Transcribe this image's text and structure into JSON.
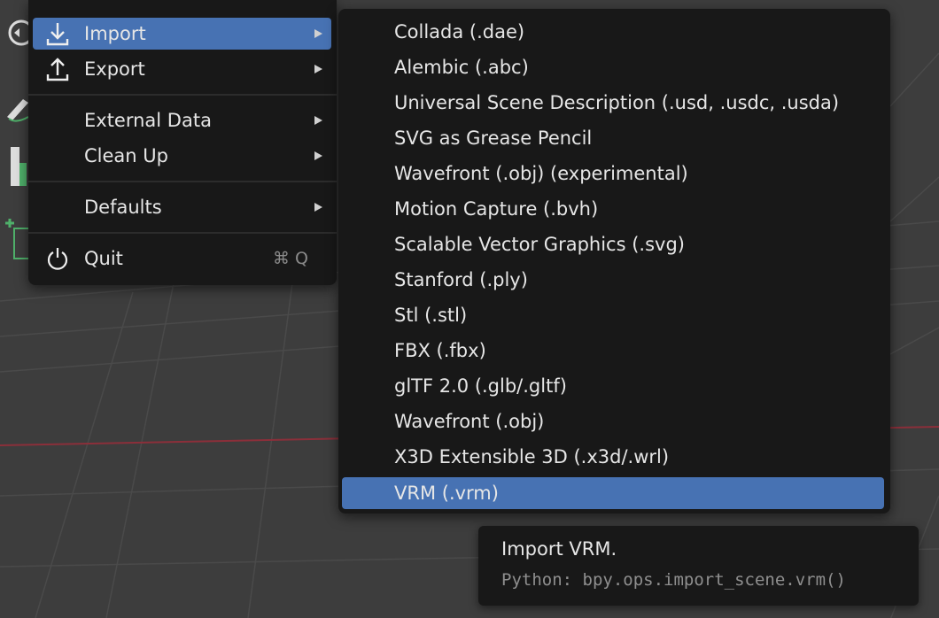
{
  "file_menu": {
    "items": [
      {
        "label": "Import",
        "icon": "import-icon",
        "has_submenu": true,
        "active": true
      },
      {
        "label": "Export",
        "icon": "export-icon",
        "has_submenu": true
      },
      {
        "label": "External Data",
        "has_submenu": true
      },
      {
        "label": "Clean Up",
        "has_submenu": true
      },
      {
        "label": "Defaults",
        "has_submenu": true
      },
      {
        "label": "Quit",
        "icon": "power-icon",
        "shortcut": "⌘ Q"
      }
    ]
  },
  "import_submenu": {
    "items": [
      {
        "label": "Collada (.dae)"
      },
      {
        "label": "Alembic (.abc)"
      },
      {
        "label": "Universal Scene Description (.usd, .usdc, .usda)"
      },
      {
        "label": "SVG as Grease Pencil"
      },
      {
        "label": "Wavefront (.obj) (experimental)"
      },
      {
        "label": "Motion Capture (.bvh)"
      },
      {
        "label": "Scalable Vector Graphics (.svg)"
      },
      {
        "label": "Stanford (.ply)"
      },
      {
        "label": "Stl (.stl)"
      },
      {
        "label": "FBX (.fbx)"
      },
      {
        "label": "glTF 2.0 (.glb/.gltf)"
      },
      {
        "label": "Wavefront (.obj)"
      },
      {
        "label": "X3D Extensible 3D (.x3d/.wrl)"
      },
      {
        "label": "VRM (.vrm)",
        "active": true
      }
    ]
  },
  "tooltip": {
    "title": "Import VRM.",
    "python": "Python: bpy.ops.import_scene.vrm()"
  },
  "colors": {
    "menu_bg": "#181818",
    "highlight": "#4772b3",
    "viewport_bg": "#3d3d3d",
    "x_axis_line": "#8b2f3a"
  }
}
